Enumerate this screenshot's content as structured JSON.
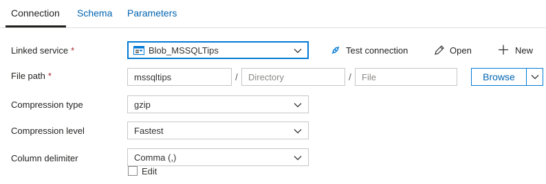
{
  "tabs": [
    {
      "label": "Connection",
      "active": true
    },
    {
      "label": "Schema",
      "active": false
    },
    {
      "label": "Parameters",
      "active": false
    }
  ],
  "linked_service": {
    "label": "Linked service",
    "required": "*",
    "value": "Blob_MSSQLTips",
    "icon": "storage-blob-icon"
  },
  "actions": {
    "test_connection": "Test connection",
    "open": "Open",
    "new": "New"
  },
  "file_path": {
    "label": "File path",
    "required": "*",
    "container": "mssqltips",
    "separator": "/",
    "directory_placeholder": "Directory",
    "file_placeholder": "File",
    "browse_label": "Browse"
  },
  "compression_type": {
    "label": "Compression type",
    "value": "gzip"
  },
  "compression_level": {
    "label": "Compression level",
    "value": "Fastest"
  },
  "column_delimiter": {
    "label": "Column delimiter",
    "value": "Comma (,)",
    "edit_label": "Edit",
    "edit_checked": false
  },
  "colors": {
    "accent": "#0078d4",
    "link": "#0063b1",
    "required": "#a4262c",
    "border": "#c8c6c4"
  }
}
